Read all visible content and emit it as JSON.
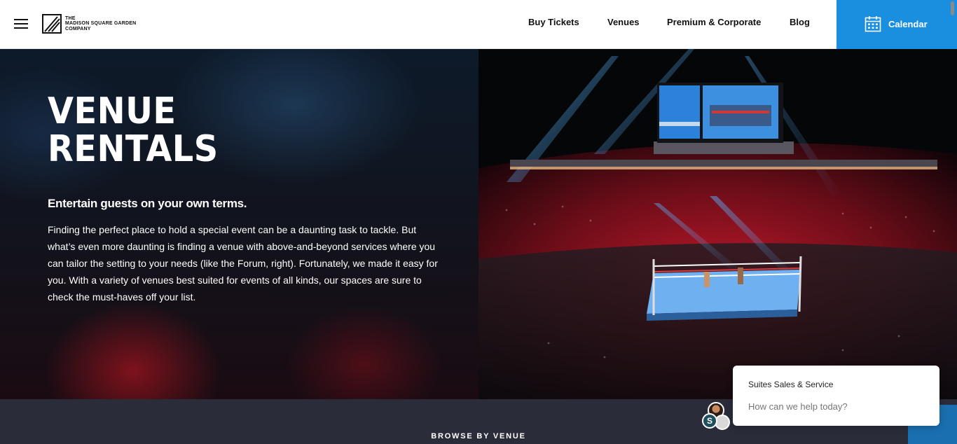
{
  "header": {
    "logo_lines": [
      "THE",
      "MADISON SQUARE GARDEN",
      "COMPANY"
    ],
    "nav": [
      {
        "label": "Buy Tickets"
      },
      {
        "label": "Venues"
      },
      {
        "label": "Premium & Corporate"
      },
      {
        "label": "Blog"
      }
    ],
    "calendar_label": "Calendar",
    "calendar_icon": "calendar-icon",
    "menu_icon": "hamburger-menu-icon"
  },
  "hero": {
    "title_line1": "VENUE",
    "title_line2": "RENTALS",
    "subtitle": "Entertain guests on your own terms.",
    "body": "Finding the perfect place to hold a special event can be a daunting task to tackle. But what’s even more daunting is finding a venue with above-and-beyond services where you can tailor the setting to your needs (like the Forum, right). Fortunately, we made it easy for you. With a variety of venues best suited for events of all kinds, our spaces are sure to check the must-haves off your list."
  },
  "browse": {
    "label": "BROWSE BY VENUE"
  },
  "chat": {
    "title": "Suites Sales & Service",
    "prompt": "How can we help today?",
    "avatar_initial": "S"
  },
  "colors": {
    "accent": "#1a8fe0",
    "band": "#2a2c3a",
    "text_dark": "#111111"
  }
}
